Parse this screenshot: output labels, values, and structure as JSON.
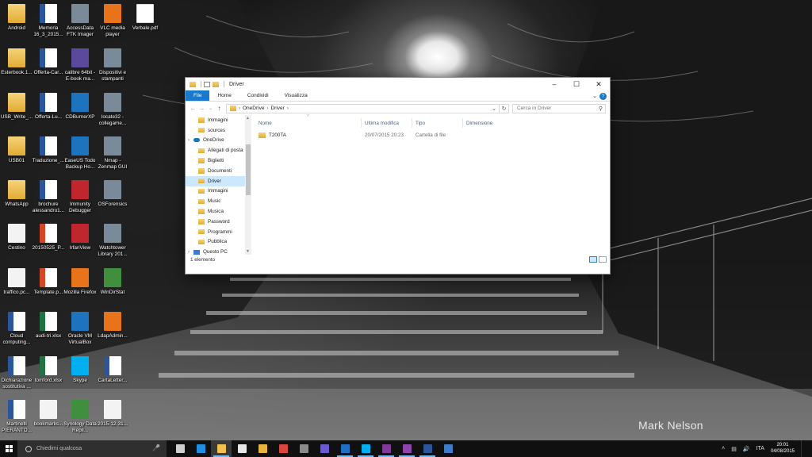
{
  "wallpaper": {
    "watermark": "Mark Nelson"
  },
  "desktop_icons": [
    {
      "label": "Android",
      "glyph": "folder",
      "col": 0,
      "row": 0
    },
    {
      "label": "Memoria 16_3_2015...",
      "glyph": "word",
      "col": 1,
      "row": 0
    },
    {
      "label": "AccessData FTK Imager",
      "glyph": "grey",
      "col": 2,
      "row": 0
    },
    {
      "label": "VLC media player",
      "glyph": "orange",
      "col": 3,
      "row": 0
    },
    {
      "label": "Verbale.pdf",
      "glyph": "pdf",
      "col": 4,
      "row": 0
    },
    {
      "label": "Esterbook.1...",
      "glyph": "folder",
      "col": 0,
      "row": 1
    },
    {
      "label": "Offerta-Car...",
      "glyph": "word",
      "col": 1,
      "row": 1
    },
    {
      "label": "calibre 64bit - E-book ma...",
      "glyph": "purple",
      "col": 2,
      "row": 1
    },
    {
      "label": "Dispositivi e stampanti",
      "glyph": "grey",
      "col": 3,
      "row": 1
    },
    {
      "label": "USB_Write_...",
      "glyph": "folder",
      "col": 0,
      "row": 2
    },
    {
      "label": "Offerta-Lu...",
      "glyph": "word",
      "col": 1,
      "row": 2
    },
    {
      "label": "CDBurnerXP",
      "glyph": "blue",
      "col": 2,
      "row": 2
    },
    {
      "label": "locate32 - collegame...",
      "glyph": "grey",
      "col": 3,
      "row": 2
    },
    {
      "label": "USB01",
      "glyph": "folder",
      "col": 0,
      "row": 3
    },
    {
      "label": "Traduzione_...",
      "glyph": "word",
      "col": 1,
      "row": 3
    },
    {
      "label": "EaseUS Todo Backup Ho...",
      "glyph": "blue",
      "col": 2,
      "row": 3
    },
    {
      "label": "Nmap - Zenmap GUI",
      "glyph": "grey",
      "col": 3,
      "row": 3
    },
    {
      "label": "WhatsApp",
      "glyph": "folder",
      "col": 0,
      "row": 4
    },
    {
      "label": "brochure alessandro1...",
      "glyph": "word",
      "col": 1,
      "row": 4
    },
    {
      "label": "Immunity Debugger",
      "glyph": "red",
      "col": 2,
      "row": 4
    },
    {
      "label": "OSForensics",
      "glyph": "grey",
      "col": 3,
      "row": 4
    },
    {
      "label": "Cestino",
      "glyph": "white",
      "col": 0,
      "row": 5
    },
    {
      "label": "20150525_P...",
      "glyph": "ppt",
      "col": 1,
      "row": 5
    },
    {
      "label": "IrfanView",
      "glyph": "red",
      "col": 2,
      "row": 5
    },
    {
      "label": "Watchtower Library 201...",
      "glyph": "grey",
      "col": 3,
      "row": 5
    },
    {
      "label": "traffico.pc...",
      "glyph": "white",
      "col": 0,
      "row": 6
    },
    {
      "label": "Template.p...",
      "glyph": "ppt",
      "col": 1,
      "row": 6
    },
    {
      "label": "Mozilla Firefox",
      "glyph": "orange",
      "col": 2,
      "row": 6
    },
    {
      "label": "WinDirStat",
      "glyph": "green",
      "col": 3,
      "row": 6
    },
    {
      "label": "Cloud computing...",
      "glyph": "word",
      "col": 0,
      "row": 7
    },
    {
      "label": "audi-tri.xlsx",
      "glyph": "excel",
      "col": 1,
      "row": 7
    },
    {
      "label": "Oracle VM VirtualBox",
      "glyph": "blue",
      "col": 2,
      "row": 7
    },
    {
      "label": "LdapAdmin...",
      "glyph": "orange",
      "col": 3,
      "row": 7
    },
    {
      "label": "Dichiarazione sostitutiva ...",
      "glyph": "word",
      "col": 0,
      "row": 8
    },
    {
      "label": "tomford.xlsx",
      "glyph": "excel",
      "col": 1,
      "row": 8
    },
    {
      "label": "Skype",
      "glyph": "sky",
      "col": 2,
      "row": 8
    },
    {
      "label": "CartaLetter...",
      "glyph": "word",
      "col": 3,
      "row": 8
    },
    {
      "label": "Martinelli PIERANTO...",
      "glyph": "word",
      "col": 0,
      "row": 9
    },
    {
      "label": "bookmarks...",
      "glyph": "white",
      "col": 1,
      "row": 9
    },
    {
      "label": "Synology Data Repli...",
      "glyph": "green",
      "col": 2,
      "row": 9
    },
    {
      "label": "2015-12-31...",
      "glyph": "white",
      "col": 3,
      "row": 9
    }
  ],
  "explorer": {
    "title": "Driver",
    "ribbon_tabs": [
      "File",
      "Home",
      "Condividi",
      "Visualizza"
    ],
    "breadcrumb": [
      "OneDrive",
      "Driver"
    ],
    "search_placeholder": "Cerca in Driver",
    "nav_items": [
      {
        "label": "Immagini",
        "kind": "folder",
        "level": "sub",
        "selected": false
      },
      {
        "label": "sources",
        "kind": "folder",
        "level": "sub",
        "selected": false
      },
      {
        "label": "OneDrive",
        "kind": "onedrive",
        "level": "top",
        "selected": false
      },
      {
        "label": "Allegati di posta",
        "kind": "folder",
        "level": "sub",
        "selected": false
      },
      {
        "label": "Biglietti",
        "kind": "folder",
        "level": "sub",
        "selected": false
      },
      {
        "label": "Documenti",
        "kind": "folder",
        "level": "sub",
        "selected": false
      },
      {
        "label": "Driver",
        "kind": "folder",
        "level": "sub",
        "selected": true
      },
      {
        "label": "Immagini",
        "kind": "folder",
        "level": "sub",
        "selected": false
      },
      {
        "label": "Music",
        "kind": "folder",
        "level": "sub",
        "selected": false
      },
      {
        "label": "Musica",
        "kind": "folder",
        "level": "sub",
        "selected": false
      },
      {
        "label": "Password",
        "kind": "folder",
        "level": "sub",
        "selected": false
      },
      {
        "label": "Programmi",
        "kind": "folder",
        "level": "sub",
        "selected": false
      },
      {
        "label": "Pubblica",
        "kind": "folder",
        "level": "sub",
        "selected": false
      },
      {
        "label": "Questo PC",
        "kind": "pc",
        "level": "top",
        "selected": false
      }
    ],
    "columns": {
      "name": "Nome",
      "modified": "Ultima modifica",
      "type": "Tipo",
      "size": "Dimensione"
    },
    "files": [
      {
        "name": "T200TA",
        "modified": "20/07/2015 20:23",
        "type": "Cartella di file",
        "size": ""
      }
    ],
    "status": "1 elemento"
  },
  "taskbar": {
    "search_placeholder": "Chiedimi qualcosa",
    "apps": [
      {
        "name": "task-view",
        "color": "#cfcfcf"
      },
      {
        "name": "edge",
        "color": "#1e8ee0"
      },
      {
        "name": "file-explorer",
        "color": "#f2c14e",
        "state": "active"
      },
      {
        "name": "store",
        "color": "#e7e7e7"
      },
      {
        "name": "chrome",
        "color": "#e8b43a"
      },
      {
        "name": "app-red",
        "color": "#d8463c"
      },
      {
        "name": "app-grey",
        "color": "#8a8a8a"
      },
      {
        "name": "app-purple",
        "color": "#6a5acd"
      },
      {
        "name": "outlook",
        "color": "#1f6fc4",
        "state": "run"
      },
      {
        "name": "skype",
        "color": "#00aff0",
        "state": "run"
      },
      {
        "name": "onenote",
        "color": "#7f3a9b",
        "state": "run"
      },
      {
        "name": "onenote-2",
        "color": "#8e44ad",
        "state": "run"
      },
      {
        "name": "word",
        "color": "#2b579a",
        "state": "run"
      },
      {
        "name": "app-blue",
        "color": "#3e7cc9"
      }
    ],
    "language": "ITA",
    "time": "20:01",
    "date": "04/08/2015"
  }
}
